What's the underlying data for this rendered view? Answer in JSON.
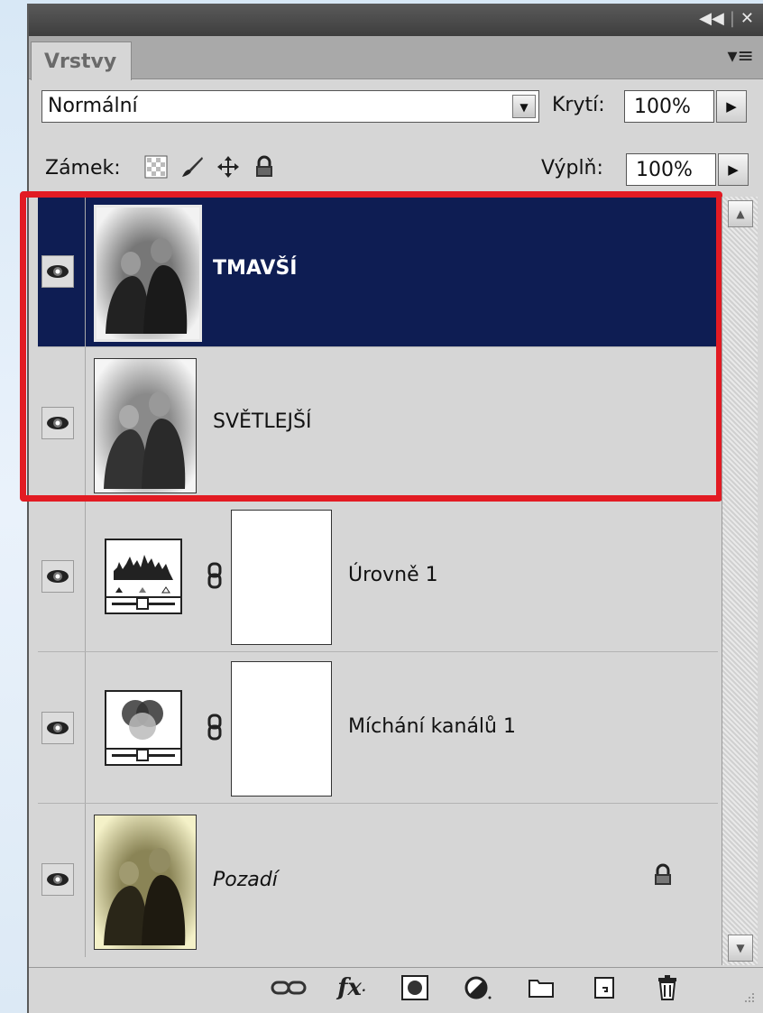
{
  "panel": {
    "tab_label": "Vrstvy"
  },
  "blend": {
    "mode": "Normální",
    "opacity_label": "Krytí:",
    "opacity_value": "100%"
  },
  "lock": {
    "label": "Zámek:",
    "fill_label": "Výplň:",
    "fill_value": "100%"
  },
  "layers": [
    {
      "name": "TMAVŠÍ",
      "type": "photo-bw",
      "selected": true,
      "visible": true
    },
    {
      "name": "SVĚTLEJŠÍ",
      "type": "photo-bw",
      "selected": false,
      "visible": true
    },
    {
      "name": "Úrovně 1",
      "type": "adjustment-levels",
      "selected": false,
      "visible": true
    },
    {
      "name": "Míchání kanálů 1",
      "type": "adjustment-channel-mixer",
      "selected": false,
      "visible": true
    },
    {
      "name": "Pozadí",
      "type": "photo-sepia",
      "selected": false,
      "visible": true,
      "locked": true
    }
  ],
  "colors": {
    "selected_row": "#0e1d53",
    "highlight_border": "#e21b23",
    "panel_bg": "#d6d6d6"
  },
  "footer_icons": [
    "link-layers-icon",
    "fx-icon",
    "add-mask-icon",
    "adjustment-layer-icon",
    "new-group-icon",
    "new-layer-icon",
    "delete-layer-icon"
  ]
}
